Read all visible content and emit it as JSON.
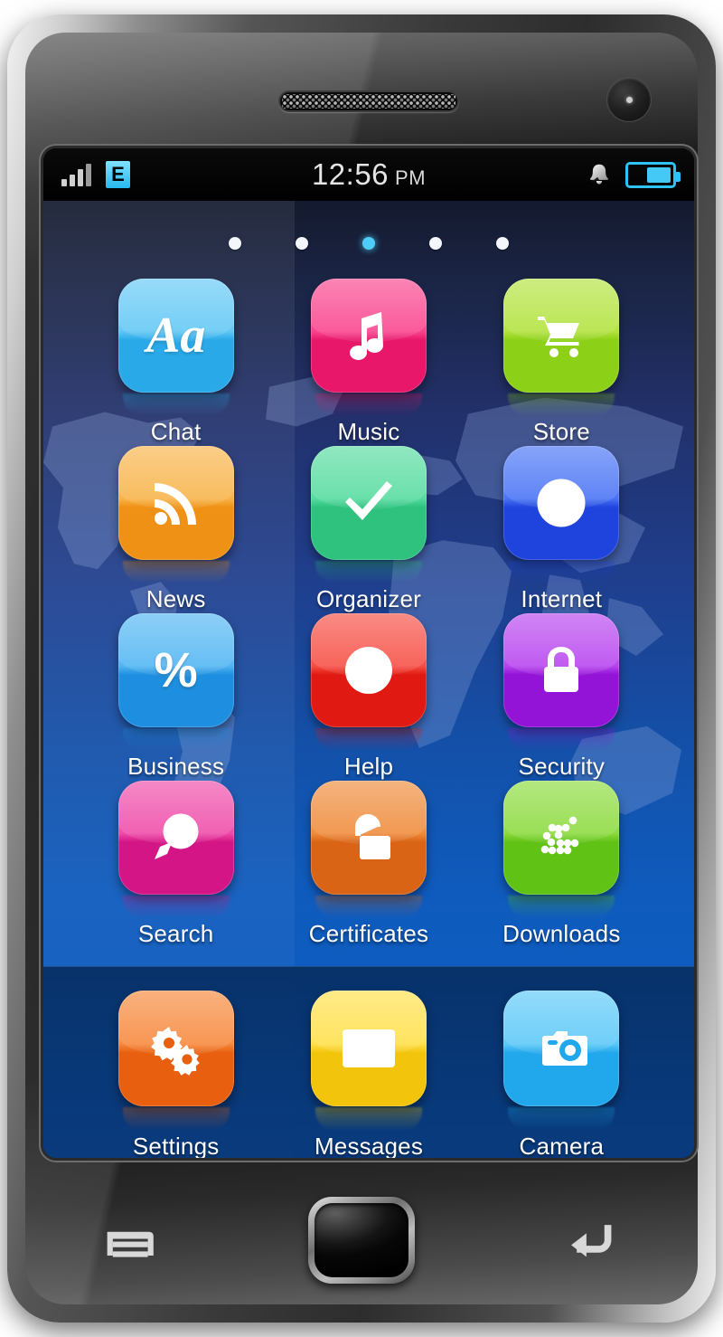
{
  "device": {
    "hardware": {
      "earpiece": "earpiece-speaker",
      "front_camera": "front-camera-lens",
      "menu_button": "Menu",
      "home_button": "Home",
      "back_button": "Back"
    }
  },
  "status_bar": {
    "signal_icon": "signal-bars-icon",
    "network_badge": "E",
    "time": "12:56",
    "ampm": "PM",
    "sound_icon": "bell-icon",
    "battery_icon": "battery-icon",
    "battery_level_pct": 58
  },
  "home_screen": {
    "page_dots": {
      "count": 5,
      "active_index": 2
    },
    "accent_color": "#4ecdf7",
    "label_color": "#ffffff",
    "apps": [
      {
        "label": "Chat",
        "icon": "text-aa-icon",
        "color": "#29a9e8",
        "color_light": "#62c8f5"
      },
      {
        "label": "Music",
        "icon": "music-note-icon",
        "color": "#e8176a",
        "color_light": "#f9458e"
      },
      {
        "label": "Store",
        "icon": "shopping-cart-icon",
        "color": "#8cd017",
        "color_light": "#b3e33f"
      },
      {
        "label": "News",
        "icon": "rss-feed-icon",
        "color": "#ef9114",
        "color_light": "#f8b44a"
      },
      {
        "label": "Organizer",
        "icon": "checkmark-icon",
        "color": "#2ec27e",
        "color_light": "#57dca0"
      },
      {
        "label": "Internet",
        "icon": "globe-icon",
        "color": "#1f44dd",
        "color_light": "#4a74f5"
      },
      {
        "label": "Business",
        "icon": "percent-icon",
        "color": "#1e8fe0",
        "color_light": "#52b6f3"
      },
      {
        "label": "Help",
        "icon": "info-circle-icon",
        "color": "#e01a12",
        "color_light": "#f65046"
      },
      {
        "label": "Security",
        "icon": "padlock-closed-icon",
        "color": "#9313d6",
        "color_light": "#b846ef"
      },
      {
        "label": "Search",
        "icon": "magnifier-icon",
        "color": "#d41585",
        "color_light": "#ef4ca9"
      },
      {
        "label": "Certificates",
        "icon": "padlock-open-icon",
        "color": "#d96415",
        "color_light": "#ef8c3c"
      },
      {
        "label": "Downloads",
        "icon": "dotted-arrow-icon",
        "color": "#61c216",
        "color_light": "#8ddb3f"
      }
    ],
    "dock_apps": [
      {
        "label": "Settings",
        "icon": "gears-icon",
        "color": "#e8600f",
        "color_light": "#f7893c"
      },
      {
        "label": "Messages",
        "icon": "envelope-icon",
        "color": "#f2c40b",
        "color_light": "#ffe04a"
      },
      {
        "label": "Camera",
        "icon": "camera-icon",
        "color": "#21a7ec",
        "color_light": "#5cc8f8"
      }
    ]
  }
}
